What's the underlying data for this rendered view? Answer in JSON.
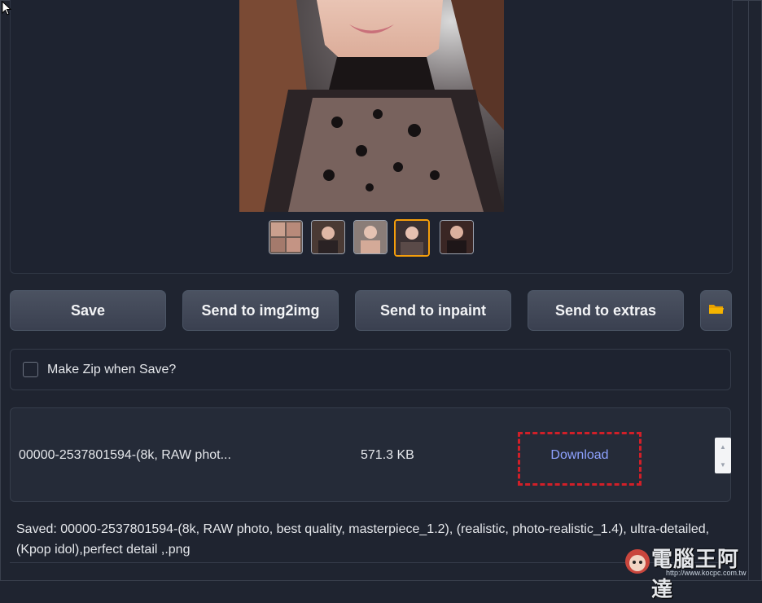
{
  "gallery": {
    "thumbnails": [
      {
        "label": "thumbnail-1",
        "selected": false
      },
      {
        "label": "thumbnail-2",
        "selected": false
      },
      {
        "label": "thumbnail-3",
        "selected": false
      },
      {
        "label": "thumbnail-4",
        "selected": true
      },
      {
        "label": "thumbnail-5",
        "selected": false
      }
    ]
  },
  "actions": {
    "save": "Save",
    "send_img2img": "Send to img2img",
    "send_inpaint": "Send to inpaint",
    "send_extras": "Send to extras",
    "folder_icon": "folder-icon"
  },
  "zip": {
    "label": "Make Zip when Save?",
    "checked": false
  },
  "file": {
    "name": "00000-2537801594-(8k, RAW phot...",
    "size": "571.3 KB",
    "download_label": "Download"
  },
  "saved_message": "Saved: 00000-2537801594-(8k, RAW photo, best quality, masterpiece_1.2), (realistic, photo-realistic_1.4), ultra-detailed, (Kpop idol),perfect detail ,.png",
  "watermark": {
    "title": "電腦王阿達",
    "url": "http://www.kocpc.com.tw"
  },
  "colors": {
    "accent_selected": "#f59e0b",
    "download_link": "#8ea2ff",
    "highlight_box": "#d11f28",
    "folder": "#f5b400"
  }
}
